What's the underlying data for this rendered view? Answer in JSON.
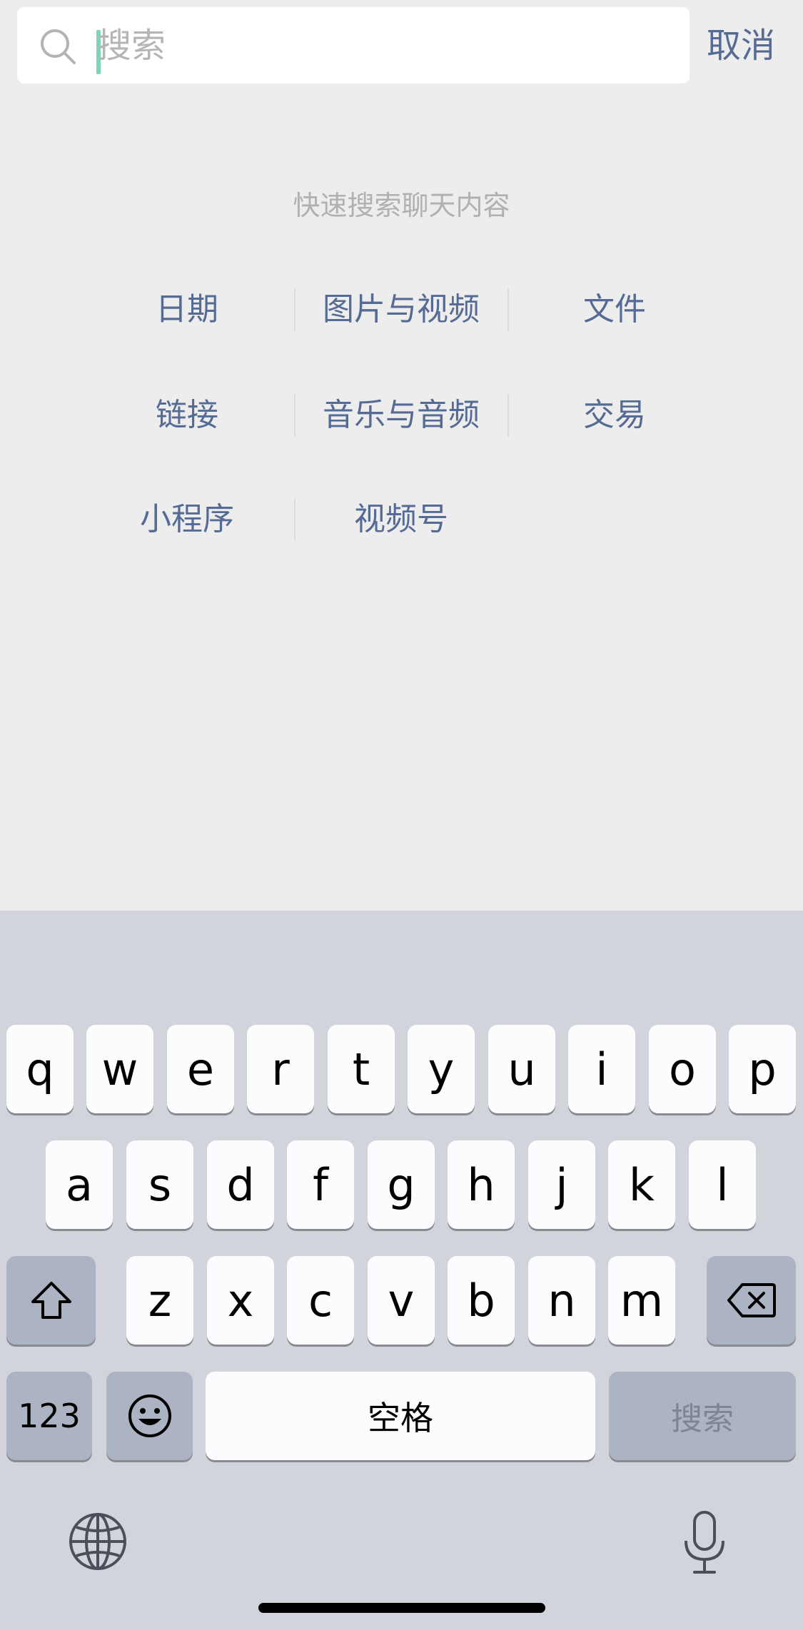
{
  "search": {
    "placeholder": "搜索",
    "cancel_label": "取消"
  },
  "quick_search": {
    "hint": "快速搜索聊天内容",
    "categories": [
      "日期",
      "图片与视频",
      "文件",
      "链接",
      "音乐与音频",
      "交易",
      "小程序",
      "视频号"
    ]
  },
  "keyboard": {
    "row1": [
      "q",
      "w",
      "e",
      "r",
      "t",
      "y",
      "u",
      "i",
      "o",
      "p"
    ],
    "row2": [
      "a",
      "s",
      "d",
      "f",
      "g",
      "h",
      "j",
      "k",
      "l"
    ],
    "row3": [
      "z",
      "x",
      "c",
      "v",
      "b",
      "n",
      "m"
    ],
    "numbers_label": "123",
    "space_label": "空格",
    "search_label": "搜索",
    "icons": [
      "shift-icon",
      "backspace-icon",
      "emoji-icon",
      "globe-icon",
      "microphone-icon"
    ]
  },
  "colors": {
    "accent": "#566b94",
    "background": "#ededed",
    "keyboard_bg": "#d1d5db",
    "caret": "#7ad6b8"
  }
}
